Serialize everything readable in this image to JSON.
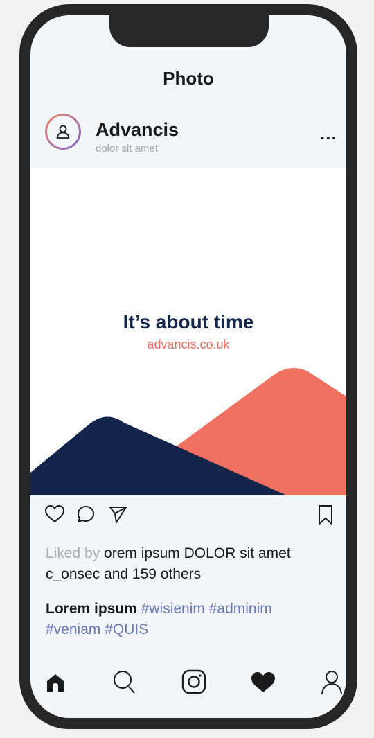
{
  "screen": {
    "title": "Photo"
  },
  "account": {
    "name": "Advancis",
    "subtitle": "dolor sit amet",
    "more_label": "..."
  },
  "post": {
    "headline": "It’s about time",
    "url": "advancis.co.uk",
    "colors": {
      "navy": "#13254a",
      "coral": "#f07162"
    }
  },
  "actions": [
    "heart-icon",
    "comment-icon",
    "send-icon",
    "bookmark-icon"
  ],
  "likes": {
    "prefix": "Liked by",
    "text": " orem ipsum DOLOR sit amet c_onsec and 159 others"
  },
  "caption": {
    "user": "Lorem ipsum",
    "tags": " #wisienim #adminim #veniam #QUIS"
  },
  "bottom_nav": [
    "home-icon",
    "search-icon",
    "instagram-icon",
    "likes-icon",
    "profile-icon"
  ]
}
